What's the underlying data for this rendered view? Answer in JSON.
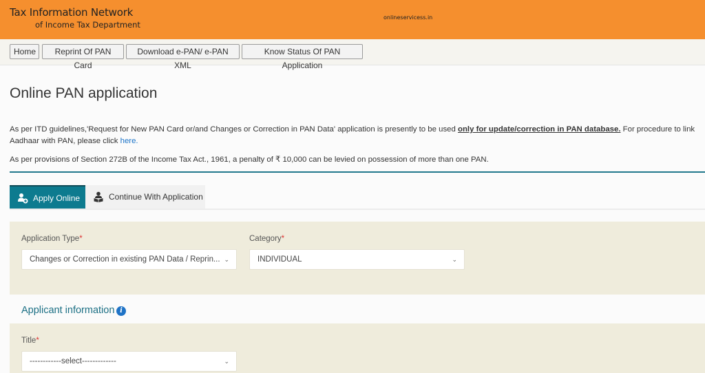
{
  "header": {
    "brand_line1": "Tax Information Network",
    "brand_line2": "of Income Tax Department",
    "watermark": "onlineservicess.in",
    "bg_color": "#f58f2e"
  },
  "nav": {
    "items": [
      {
        "label": "Home"
      },
      {
        "label": "Reprint Of PAN Card"
      },
      {
        "label": "Download e-PAN/ e-PAN XML"
      },
      {
        "label": "Know Status Of PAN Application"
      }
    ]
  },
  "main": {
    "title": "Online PAN application",
    "notice1_pre": "As per ITD guidelines,'Request for New PAN Card or/and Changes or Correction in PAN Data' application is presently to be used ",
    "notice1_bold": "only for update/correction in PAN database.",
    "notice1_post": " For procedure to link",
    "notice1_line2": "Aadhaar with PAN, please click ",
    "notice1_link": "here.",
    "notice2": "As per provisions of Section 272B of the Income Tax Act., 1961, a penalty of ₹ 10,000 can be levied on possession of more than one PAN.",
    "accent_color": "#0d7b8f"
  },
  "tabs": [
    {
      "label": "Apply Online",
      "icon": "user-add-icon",
      "active": true
    },
    {
      "label": "Continue With Application",
      "icon": "user-reading-icon",
      "active": false
    }
  ],
  "form": {
    "application_type": {
      "label": "Application Type",
      "required_mark": "*",
      "value": "Changes or Correction in existing PAN Data / Reprin..."
    },
    "category": {
      "label": "Category",
      "required_mark": "*",
      "value": "INDIVIDUAL"
    },
    "applicant_section_title": "Applicant information",
    "title_field": {
      "label": "Title",
      "required_mark": "*",
      "value": "------------select-------------"
    }
  }
}
